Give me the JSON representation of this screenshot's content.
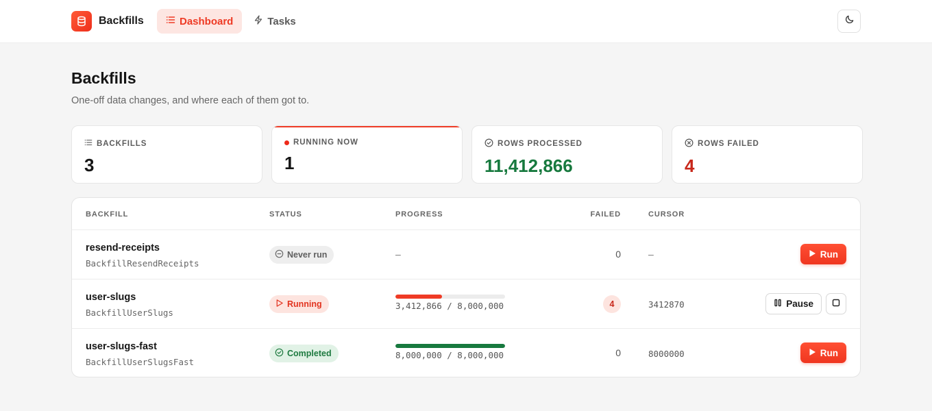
{
  "header": {
    "brand": "Backfills",
    "nav": [
      {
        "label": "Dashboard",
        "icon": "list-icon",
        "active": true
      },
      {
        "label": "Tasks",
        "icon": "bolt-icon",
        "active": false
      }
    ],
    "theme_icon": "moon-icon"
  },
  "page": {
    "title": "Backfills",
    "subtitle": "One-off data changes, and where each of them got to."
  },
  "stats": [
    {
      "label": "BACKFILLS",
      "value": "3",
      "icon": "list-icon"
    },
    {
      "label": "RUNNING NOW",
      "value": "1",
      "icon": "live-dot-icon",
      "accent": "#ef3b25"
    },
    {
      "label": "ROWS PROCESSED",
      "value": "11,412,866",
      "icon": "check-circle-icon",
      "color": "#17793e"
    },
    {
      "label": "ROWS FAILED",
      "value": "4",
      "icon": "x-circle-icon",
      "color": "#c8281b"
    }
  ],
  "table": {
    "columns": [
      "BACKFILL",
      "STATUS",
      "PROGRESS",
      "FAILED",
      "CURSOR"
    ],
    "rows": [
      {
        "name": "resend-receipts",
        "class": "BackfillResendReceipts",
        "status": "Never run",
        "progress_text": "–",
        "failed": "0",
        "cursor": "–",
        "action": "Run"
      },
      {
        "name": "user-slugs",
        "class": "BackfillUserSlugs",
        "status": "Running",
        "progress_fraction": 0.4266,
        "progress_text": "3,412,866 / 8,000,000",
        "failed": "4",
        "cursor": "3412870",
        "action": "Pause"
      },
      {
        "name": "user-slugs-fast",
        "class": "BackfillUserSlugsFast",
        "status": "Completed",
        "progress_fraction": 1.0,
        "progress_text": "8,000,000 / 8,000,000",
        "failed": "0",
        "cursor": "8000000",
        "action": "Run"
      }
    ]
  },
  "colors": {
    "accent": "#ef3b25",
    "success": "#17793e",
    "danger": "#c8281b"
  }
}
